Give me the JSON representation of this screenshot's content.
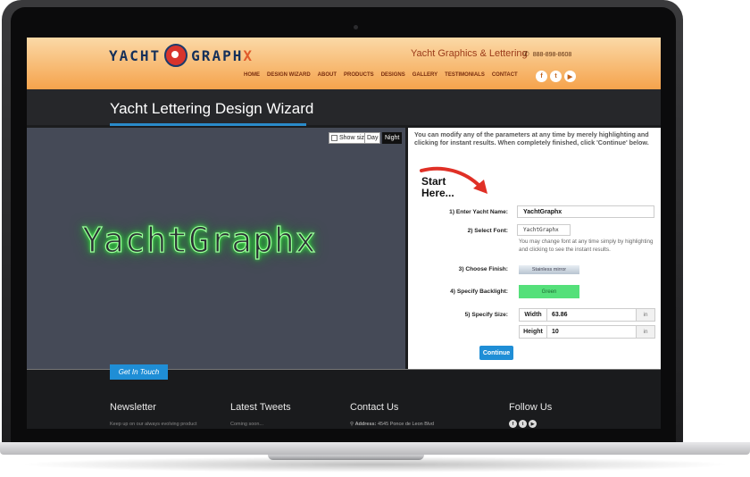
{
  "header": {
    "logo_left": "YACHT",
    "logo_right": "GRAPH",
    "logo_x": "X",
    "tagline": "Yacht Graphics & Lettering",
    "phone": "888-898-8608",
    "nav": [
      "HOME",
      "DESIGN WIZARD",
      "ABOUT",
      "PRODUCTS",
      "DESIGNS",
      "GALLERY",
      "TESTIMONIALS",
      "CONTACT"
    ],
    "social": [
      "f",
      "t",
      "yt"
    ]
  },
  "page_title": "Yacht Lettering Design Wizard",
  "preview": {
    "show_size_label": "Show size",
    "day_label": "Day",
    "night_label": "Night",
    "glow_text": "YachtGraphx"
  },
  "form": {
    "intro": "You can modify any of the parameters at any time by merely highlighting and clicking for instant results. When completely finished, click 'Continue' below.",
    "start_line1": "Start",
    "start_line2": "Here...",
    "step1_label": "1) Enter Yacht Name:",
    "yacht_name": "YachtGraphx",
    "step2_label": "2) Select Font:",
    "font_sample": "YachtGraphx",
    "font_hint": "You may change font at any time simply by highlighting and clicking to see the instant results.",
    "step3_label": "3) Choose Finish:",
    "finish": "Stainless mirror",
    "step4_label": "4) Specify Backlight:",
    "backlight": "Green",
    "step5_label": "5) Specify Size:",
    "width_label": "Width",
    "width_value": "63.86",
    "height_label": "Height",
    "height_value": "10",
    "unit": "in",
    "continue_label": "Continue"
  },
  "footer": {
    "tab_label": "Get In Touch",
    "newsletter_title": "Newsletter",
    "newsletter_text": "Keep up on our always evolving product",
    "tweets_title": "Latest Tweets",
    "tweets_text": "Coming soon...",
    "contact_title": "Contact Us",
    "address_label": "Address:",
    "address_value": "4545 Ponce de Leon Blvd",
    "follow_title": "Follow Us"
  },
  "colors": {
    "accent_blue": "#1f8ed6",
    "header_orange": "#f5a34c",
    "backlight_green": "#55e07a"
  }
}
